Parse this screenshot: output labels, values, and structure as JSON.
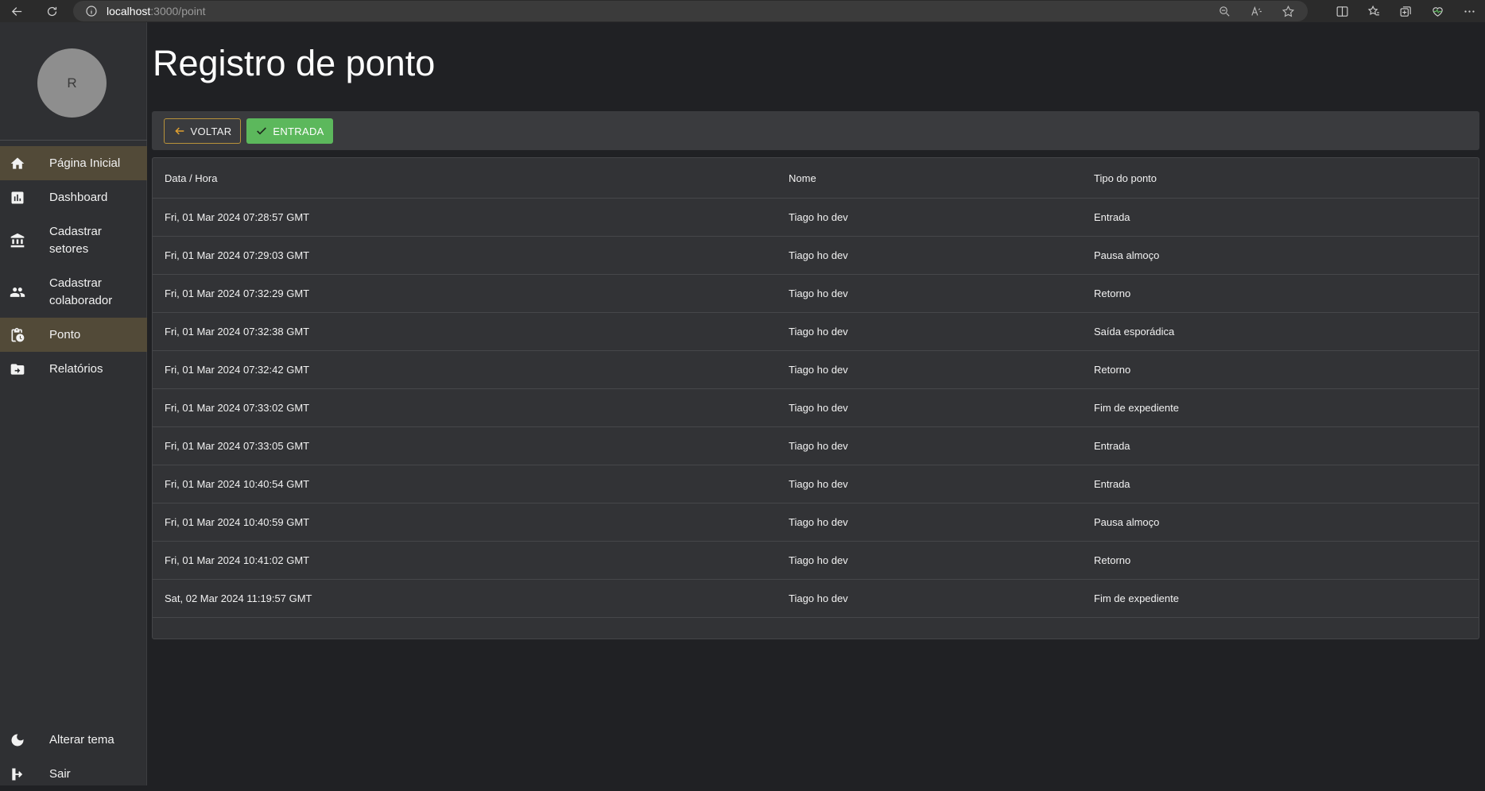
{
  "browser": {
    "url_host": "localhost",
    "url_path": ":3000/point"
  },
  "user": {
    "avatar_initial": "R"
  },
  "sidebar": {
    "items": [
      {
        "label": "Página Inicial",
        "icon": "home-icon",
        "active": true
      },
      {
        "label": "Dashboard",
        "icon": "dashboard-icon",
        "active": false
      },
      {
        "label": "Cadastrar setores",
        "icon": "bank-icon",
        "active": false
      },
      {
        "label": "Cadastrar colaborador",
        "icon": "people-icon",
        "active": false
      },
      {
        "label": "Ponto",
        "icon": "clipboard-clock-icon",
        "active": true
      },
      {
        "label": "Relatórios",
        "icon": "folder-icon",
        "active": false
      }
    ],
    "bottom": [
      {
        "label": "Alterar tema",
        "icon": "moon-icon"
      },
      {
        "label": "Sair",
        "icon": "logout-icon"
      }
    ]
  },
  "page": {
    "title": "Registro de ponto"
  },
  "toolbar": {
    "back_label": "VOLTAR",
    "entry_label": "ENTRADA",
    "entry_color": "#5cb85c",
    "back_border_color": "#b8923a"
  },
  "table": {
    "headers": [
      "Data / Hora",
      "Nome",
      "Tipo do ponto"
    ],
    "rows": [
      [
        "Fri, 01 Mar 2024 07:28:57 GMT",
        "Tiago ho dev",
        "Entrada"
      ],
      [
        "Fri, 01 Mar 2024 07:29:03 GMT",
        "Tiago ho dev",
        "Pausa almoço"
      ],
      [
        "Fri, 01 Mar 2024 07:32:29 GMT",
        "Tiago ho dev",
        "Retorno"
      ],
      [
        "Fri, 01 Mar 2024 07:32:38 GMT",
        "Tiago ho dev",
        "Saída esporádica"
      ],
      [
        "Fri, 01 Mar 2024 07:32:42 GMT",
        "Tiago ho dev",
        "Retorno"
      ],
      [
        "Fri, 01 Mar 2024 07:33:02 GMT",
        "Tiago ho dev",
        "Fim de expediente"
      ],
      [
        "Fri, 01 Mar 2024 07:33:05 GMT",
        "Tiago ho dev",
        "Entrada"
      ],
      [
        "Fri, 01 Mar 2024 10:40:54 GMT",
        "Tiago ho dev",
        "Entrada"
      ],
      [
        "Fri, 01 Mar 2024 10:40:59 GMT",
        "Tiago ho dev",
        "Pausa almoço"
      ],
      [
        "Fri, 01 Mar 2024 10:41:02 GMT",
        "Tiago ho dev",
        "Retorno"
      ],
      [
        "Sat, 02 Mar 2024 11:19:57 GMT",
        "Tiago ho dev",
        "Fim de expediente"
      ]
    ]
  }
}
